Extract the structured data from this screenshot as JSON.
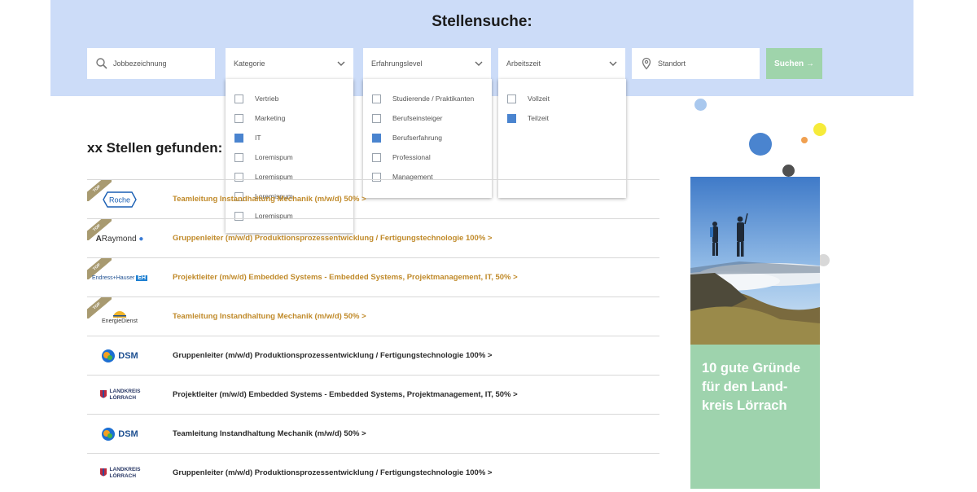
{
  "search": {
    "heading": "Stellensuche:",
    "job_title_placeholder": "Jobbezeichnung",
    "category_label": "Kategorie",
    "experience_label": "Erfahrungslevel",
    "worktime_label": "Arbeitszeit",
    "location_placeholder": "Standort",
    "submit_label": "Suchen →"
  },
  "dropdowns": {
    "category": [
      {
        "label": "Vertrieb",
        "checked": false
      },
      {
        "label": "Marketing",
        "checked": false
      },
      {
        "label": "IT",
        "checked": true
      },
      {
        "label": "Loremispum",
        "checked": false
      },
      {
        "label": "Loremispum",
        "checked": false
      },
      {
        "label": "Loremispum",
        "checked": false
      },
      {
        "label": "Loremispum",
        "checked": false
      }
    ],
    "experience": [
      {
        "label": "Studierende / Praktikanten",
        "checked": false
      },
      {
        "label": "Berufseinsteiger",
        "checked": false
      },
      {
        "label": "Berufserfahrung",
        "checked": true
      },
      {
        "label": "Professional",
        "checked": false
      },
      {
        "label": "Management",
        "checked": false
      }
    ],
    "worktime": [
      {
        "label": "Vollzeit",
        "checked": false
      },
      {
        "label": "Teilzeit",
        "checked": true
      }
    ]
  },
  "results": {
    "count_text": "xx Stellen gefunden:",
    "top_badge": "TOP",
    "jobs": [
      {
        "company": "Roche",
        "title": "Teamleitung Instandhaltung Mechanik (m/w/d) 50%   >",
        "top": true
      },
      {
        "company": "ARaymond",
        "title": "Gruppenleiter (m/w/d) Produktionsprozessentwicklung / Fertigungstechnologie 100% >",
        "top": true
      },
      {
        "company": "Endress+Hauser",
        "title": "Projektleiter (m/w/d) Embedded Systems - Embedded Systems, Projektmanagement, IT, 50%  >",
        "top": true
      },
      {
        "company": "EnergieDienst",
        "title": "Teamleitung Instandhaltung Mechanik (m/w/d) 50%    >",
        "top": true
      },
      {
        "company": "DSM",
        "title": "Gruppenleiter (m/w/d) Produktionsprozessentwicklung / Fertigungstechnologie 100% >",
        "top": false
      },
      {
        "company": "Landkreis Lörrach",
        "title": "Projektleiter (m/w/d) Embedded Systems - Embedded Systems, Projektmanagement, IT, 50%  >",
        "top": false
      },
      {
        "company": "DSM",
        "title": "Teamleitung Instandhaltung Mechanik (m/w/d) 50%    >",
        "top": false
      },
      {
        "company": "Landkreis Lörrach",
        "title": "Gruppenleiter (m/w/d) Produktionsprozessentwicklung / Fertigungstechnologie 100% >",
        "top": false
      }
    ]
  },
  "ad": {
    "text": "10 gute Gründe für den Land-kreis  Lörrach"
  },
  "logos": {
    "roche": "Roche",
    "araymond_a": "A",
    "araymond": "Raymond",
    "endress": "Endress+Hauser",
    "eh": "EH",
    "energiedienst": "EnergieDienst",
    "dsm": "DSM",
    "landkreis": "LANDKREIS",
    "loerrach": "LÖRRACH"
  },
  "colors": {
    "hero_bg": "#ccdcf8",
    "accent_blue": "#4a84cf",
    "top_title": "#c08a2a",
    "search_button": "#9fd4ab",
    "ad_green": "#9ed3ad"
  }
}
